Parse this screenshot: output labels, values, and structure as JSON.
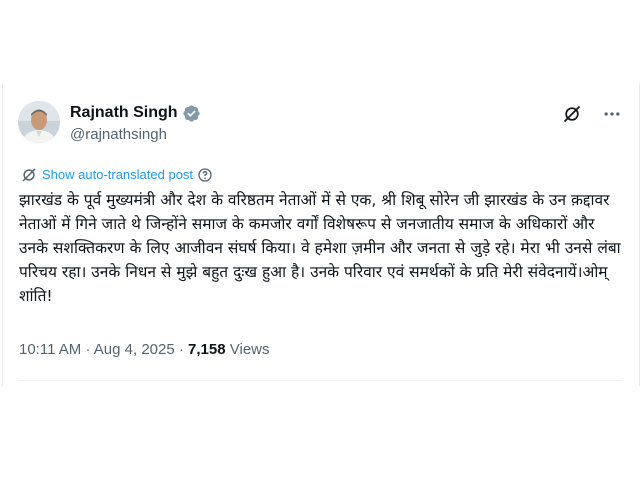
{
  "author": {
    "name": "Rajnath Singh",
    "handle": "@rajnathsingh",
    "verified_icon": "verified-badge-icon",
    "verified_color": "#829aab"
  },
  "header_icons": [
    "grok-slash-icon",
    "more-icon"
  ],
  "translate_label": "Show auto-translated post",
  "tweet_text": "झारखंड के पूर्व मुख्यमंत्री और देश के वरिष्ठतम नेताओं में से एक, श्री शिबू सोरेन जी झारखंड के उन क़द्दावर नेताओं में गिने जाते थे जिन्होंने समाज के कमजोर वर्गों विशेषरूप से जनजातीय समाज के अधिकारों और उनके सशक्तिकरण के लिए आजीवन संघर्ष किया। वे हमेशा ज़मीन और जनता से जुड़े रहे। मेरा भी उनसे लंबा परिचय रहा। उनके निधन से मुझे बहुत दुःख हुआ है। उनके परिवार एवं समर्थकों के प्रति मेरी संवेदनायें।ओम् शांति!",
  "meta": {
    "time": "10:11 AM",
    "separator": "·",
    "date": "Aug 4, 2025",
    "views_count": "7,158",
    "views_label": "Views"
  },
  "colors": {
    "link": "#1d9bf0",
    "secondary": "#536471",
    "primary": "#0f1419"
  }
}
